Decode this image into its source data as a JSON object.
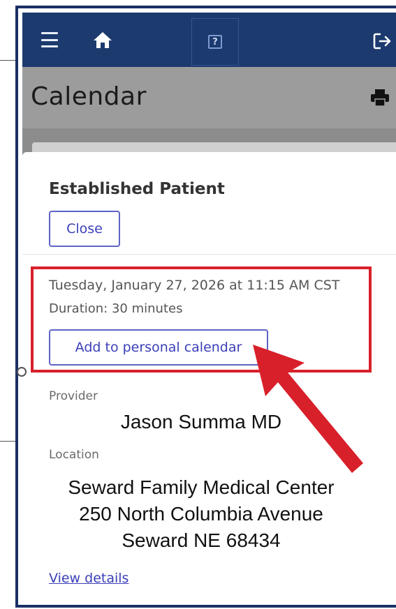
{
  "nav": {
    "menu_icon": "hamburger-menu-icon",
    "home_icon": "home-icon",
    "help_icon": "help-icon",
    "help_glyph": "?",
    "logout_icon": "logout-icon",
    "bar_color": "#1c3a6e"
  },
  "header": {
    "title": "Calendar",
    "print_icon": "print-icon"
  },
  "modal": {
    "title": "Established Patient",
    "close_label": "Close",
    "appointment": {
      "datetime": "Tuesday, January 27, 2026 at 11:15 AM CST",
      "duration": "Duration: 30 minutes",
      "add_calendar_label": "Add to personal calendar"
    },
    "provider_label": "Provider",
    "provider_name": "Jason Summa MD",
    "location_label": "Location",
    "location_lines": [
      "Seward Family Medical Center",
      "250 North Columbia Avenue",
      "Seward NE 68434"
    ],
    "view_details_label": "View details"
  },
  "annotation": {
    "highlight_color": "#d8202a",
    "arrow_color": "#d8202a"
  }
}
